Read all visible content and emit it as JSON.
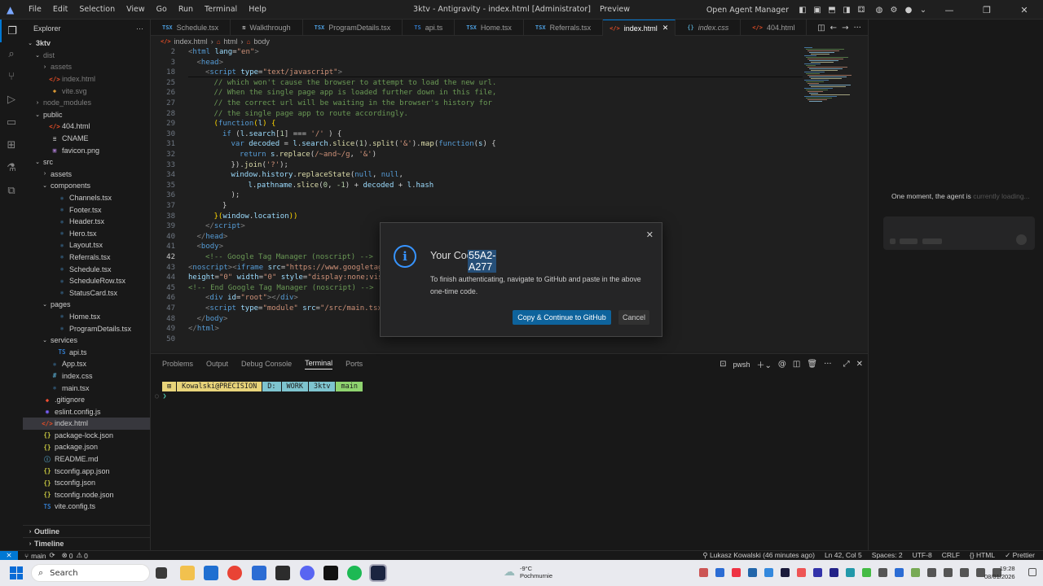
{
  "titlebar": {
    "menu": [
      "File",
      "Edit",
      "Selection",
      "View",
      "Go",
      "Run",
      "Terminal",
      "Help"
    ],
    "title": "3ktv - Antigravity - index.html [Administrator]",
    "preview": "Preview",
    "open_agent_manager": "Open Agent Manager"
  },
  "sidebar": {
    "header": "Explorer",
    "root": "3ktv",
    "tree": [
      {
        "label": "dist",
        "type": "folder",
        "depth": 1,
        "open": true,
        "dim": true
      },
      {
        "label": "assets",
        "type": "folder",
        "depth": 2,
        "open": false,
        "dim": true
      },
      {
        "label": "index.html",
        "type": "html",
        "depth": 2,
        "dim": true
      },
      {
        "label": "vite.svg",
        "type": "svg",
        "depth": 2,
        "dim": true
      },
      {
        "label": "node_modules",
        "type": "folder",
        "depth": 1,
        "open": false,
        "dim": true
      },
      {
        "label": "public",
        "type": "folder",
        "depth": 1,
        "open": true
      },
      {
        "label": "404.html",
        "type": "html",
        "depth": 2
      },
      {
        "label": "CNAME",
        "type": "text",
        "depth": 2
      },
      {
        "label": "favicon.png",
        "type": "image",
        "depth": 2
      },
      {
        "label": "src",
        "type": "folder",
        "depth": 1,
        "open": true
      },
      {
        "label": "assets",
        "type": "folder",
        "depth": 2,
        "open": false
      },
      {
        "label": "components",
        "type": "folder",
        "depth": 2,
        "open": true
      },
      {
        "label": "Channels.tsx",
        "type": "tsx",
        "depth": 3
      },
      {
        "label": "Footer.tsx",
        "type": "tsx",
        "depth": 3
      },
      {
        "label": "Header.tsx",
        "type": "tsx",
        "depth": 3
      },
      {
        "label": "Hero.tsx",
        "type": "tsx",
        "depth": 3
      },
      {
        "label": "Layout.tsx",
        "type": "tsx",
        "depth": 3
      },
      {
        "label": "Referrals.tsx",
        "type": "tsx",
        "depth": 3
      },
      {
        "label": "Schedule.tsx",
        "type": "tsx",
        "depth": 3
      },
      {
        "label": "ScheduleRow.tsx",
        "type": "tsx",
        "depth": 3
      },
      {
        "label": "StatusCard.tsx",
        "type": "tsx",
        "depth": 3
      },
      {
        "label": "pages",
        "type": "folder",
        "depth": 2,
        "open": true
      },
      {
        "label": "Home.tsx",
        "type": "tsx",
        "depth": 3
      },
      {
        "label": "ProgramDetails.tsx",
        "type": "tsx",
        "depth": 3
      },
      {
        "label": "services",
        "type": "folder",
        "depth": 2,
        "open": true
      },
      {
        "label": "api.ts",
        "type": "ts",
        "depth": 3
      },
      {
        "label": "App.tsx",
        "type": "tsx",
        "depth": 2
      },
      {
        "label": "index.css",
        "type": "css",
        "depth": 2
      },
      {
        "label": "main.tsx",
        "type": "tsx",
        "depth": 2
      },
      {
        "label": ".gitignore",
        "type": "git",
        "depth": 1
      },
      {
        "label": "eslint.config.js",
        "type": "eslint",
        "depth": 1
      },
      {
        "label": "index.html",
        "type": "html",
        "depth": 1,
        "selected": true
      },
      {
        "label": "package-lock.json",
        "type": "json",
        "depth": 1
      },
      {
        "label": "package.json",
        "type": "json",
        "depth": 1
      },
      {
        "label": "README.md",
        "type": "md",
        "depth": 1
      },
      {
        "label": "tsconfig.app.json",
        "type": "json",
        "depth": 1
      },
      {
        "label": "tsconfig.json",
        "type": "json",
        "depth": 1
      },
      {
        "label": "tsconfig.node.json",
        "type": "json",
        "depth": 1
      },
      {
        "label": "vite.config.ts",
        "type": "ts",
        "depth": 1
      }
    ],
    "outline": "Outline",
    "timeline": "Timeline"
  },
  "tabs": [
    {
      "label": "Schedule.tsx",
      "icon": "TSX",
      "color": "#4d9fe0"
    },
    {
      "label": "Walkthrough",
      "icon": "≋",
      "color": "#ccc"
    },
    {
      "label": "ProgramDetails.tsx",
      "icon": "TSX",
      "color": "#4d9fe0"
    },
    {
      "label": "api.ts",
      "icon": "TS",
      "color": "#3178c6"
    },
    {
      "label": "Home.tsx",
      "icon": "TSX",
      "color": "#4d9fe0"
    },
    {
      "label": "Referrals.tsx",
      "icon": "TSX",
      "color": "#4d9fe0"
    },
    {
      "label": "index.html",
      "icon": "</>",
      "color": "#e44d26",
      "active": true
    },
    {
      "label": "index.css",
      "icon": "{}",
      "color": "#519aba",
      "italic": true
    },
    {
      "label": "404.html",
      "icon": "</>",
      "color": "#e44d26"
    }
  ],
  "breadcrumb": [
    "index.html",
    "html",
    "body"
  ],
  "editor": {
    "lines": [
      {
        "n": "2",
        "html": "<span class='p'>&lt;</span><span class='k'>html</span> <span class='a'>lang</span>=<span class='s'>\"en\"</span><span class='p'>&gt;</span>",
        "indent": 0
      },
      {
        "n": "3",
        "html": "<span class='p'>&lt;</span><span class='k'>head</span><span class='p'>&gt;</span>",
        "indent": 1
      },
      {
        "n": "18",
        "html": "<span class='p'>&lt;</span><span class='k'>script</span> <span class='a'>type</span>=<span class='s'>\"text/javascript\"</span><span class='p'>&gt;</span>",
        "indent": 2
      },
      {
        "n": "25",
        "html": "<span class='c'>// which won't cause the browser to attempt to load the new url.</span>",
        "indent": 3
      },
      {
        "n": "26",
        "html": "<span class='c'>// When the single page app is loaded further down in this file,</span>",
        "indent": 3
      },
      {
        "n": "27",
        "html": "<span class='c'>// the correct url will be waiting in the browser's history for</span>",
        "indent": 3
      },
      {
        "n": "28",
        "html": "<span class='c'>// the single page app to route accordingly.</span>",
        "indent": 3
      },
      {
        "n": "29",
        "html": "<span class='y'>(</span><span class='k'>function</span><span class='y'>(</span><span class='v'>l</span><span class='y'>)</span> <span class='y'>{</span>",
        "indent": 3
      },
      {
        "n": "30",
        "html": "<span class='k'>if</span> (<span class='v'>l</span>.<span class='v'>search</span>[<span class='n'>1</span>] === <span class='s'>'/'</span> ) {",
        "indent": 4
      },
      {
        "n": "31",
        "html": "<span class='k'>var</span> <span class='v'>decoded</span> = <span class='v'>l</span>.<span class='v'>search</span>.<span class='f'>slice</span>(<span class='n'>1</span>).<span class='f'>split</span>(<span class='s'>'&amp;'</span>).<span class='f'>map</span>(<span class='k'>function</span>(<span class='v'>s</span>) {",
        "indent": 5
      },
      {
        "n": "32",
        "html": "<span class='k'>return</span> <span class='v'>s</span>.<span class='f'>replace</span>(<span class='s'>/~and~/g</span>, <span class='s'>'&amp;'</span>)",
        "indent": 6
      },
      {
        "n": "33",
        "html": "}).<span class='f'>join</span>(<span class='s'>'?'</span>);",
        "indent": 5
      },
      {
        "n": "34",
        "html": "<span class='v'>window</span>.<span class='v'>history</span>.<span class='f'>replaceState</span>(<span class='k'>null</span>, <span class='k'>null</span>,",
        "indent": 5
      },
      {
        "n": "35",
        "html": "<span class='v'>l</span>.<span class='v'>pathname</span>.<span class='f'>slice</span>(<span class='n'>0</span>, <span class='n'>-1</span>) + <span class='v'>decoded</span> + <span class='v'>l</span>.<span class='v'>hash</span>",
        "indent": 7
      },
      {
        "n": "36",
        "html": ");",
        "indent": 5
      },
      {
        "n": "37",
        "html": "}",
        "indent": 4
      },
      {
        "n": "38",
        "html": "<span class='y'>}</span><span class='y'>(</span><span class='v'>window</span>.<span class='v'>location</span><span class='y'>))</span>",
        "indent": 3
      },
      {
        "n": "39",
        "html": "<span class='p'>&lt;/</span><span class='k'>script</span><span class='p'>&gt;</span>",
        "indent": 2
      },
      {
        "n": "40",
        "html": "<span class='p'>&lt;/</span><span class='k'>head</span><span class='p'>&gt;</span>",
        "indent": 1
      },
      {
        "n": "41",
        "html": "<span class='p'>&lt;</span><span class='k'>body</span><span class='p'>&gt;</span>",
        "indent": 1
      },
      {
        "n": "42",
        "html": "<span class='c'>&lt;!-- Google Tag Manager (noscript) --&gt;</span>",
        "indent": 2
      },
      {
        "n": "43",
        "html": "<span class='p'>&lt;</span><span class='k'>noscript</span><span class='p'>&gt;&lt;</span><span class='k'>iframe</span> <span class='a'>src</span>=<span class='s'>\"https://www.googletagma</span>",
        "indent": 0
      },
      {
        "n": "44",
        "html": "<span class='a'>height</span>=<span class='s'>\"0\"</span> <span class='a'>width</span>=<span class='s'>\"0\"</span> <span class='a'>style</span>=<span class='s'>\"display:none;visib</span>",
        "indent": 0
      },
      {
        "n": "45",
        "html": "<span class='c'>&lt;!-- End Google Tag Manager (noscript) --&gt;</span>",
        "indent": 0
      },
      {
        "n": "46",
        "html": "<span class='p'>&lt;</span><span class='k'>div</span> <span class='a'>id</span>=<span class='s'>\"root\"</span><span class='p'>&gt;&lt;/</span><span class='k'>div</span><span class='p'>&gt;</span>",
        "indent": 2
      },
      {
        "n": "47",
        "html": "<span class='p'>&lt;</span><span class='k'>script</span> <span class='a'>type</span>=<span class='s'>\"module\"</span> <span class='a'>src</span>=<span class='s'>\"/src/main.tsx\"</span><span class='p'>&gt;</span>",
        "indent": 2
      },
      {
        "n": "48",
        "html": "<span class='p'>&lt;/</span><span class='k'>body</span><span class='p'>&gt;</span>",
        "indent": 1
      },
      {
        "n": "49",
        "html": "<span class='p'>&lt;/</span><span class='k'>html</span><span class='p'>&gt;</span>",
        "indent": 0
      },
      {
        "n": "50",
        "html": "",
        "indent": 0
      }
    ]
  },
  "panel": {
    "tabs": [
      "Problems",
      "Output",
      "Debug Console",
      "Terminal",
      "Ports"
    ],
    "active_tab": "Terminal",
    "shell": "pwsh",
    "prompt": [
      {
        "text": "⊞",
        "bg": "#e8d47a"
      },
      {
        "text": "Kowalski@PRECISION",
        "bg": "#e8d47a"
      },
      {
        "text": "D:",
        "bg": "#7ec4cf"
      },
      {
        "text": "WORK",
        "bg": "#7ec4cf"
      },
      {
        "text": "3ktv",
        "bg": "#7ec4cf"
      },
      {
        "text": "main",
        "bg": "#8fd36f"
      }
    ],
    "caret": "❯"
  },
  "agent": {
    "loading_text": "One moment, the agent is",
    "loading_fade": "currently loading..."
  },
  "dialog": {
    "title_prefix": "Your Code:",
    "code": "55A2-A277",
    "description": "To finish authenticating, navigate to GitHub and paste in the above one-time code.",
    "primary": "Copy & Continue to GitHub",
    "secondary": "Cancel"
  },
  "status": {
    "branch": "main",
    "errors": "0",
    "warnings": "0",
    "blame": "Lukasz Kowalski (46 minutes ago)",
    "position": "Ln 42, Col 5",
    "spaces": "Spaces: 2",
    "encoding": "UTF-8",
    "eol": "CRLF",
    "language": "HTML",
    "prettier": "Prettier"
  },
  "taskbar": {
    "search": "Search",
    "weather_temp": "-9°C",
    "weather_desc": "Pochmurnie",
    "time": "19:28",
    "date": "08/01/2026"
  }
}
